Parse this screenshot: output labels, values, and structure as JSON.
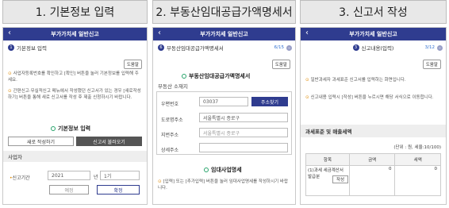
{
  "headers": [
    "1. 기본정보 입력",
    "2. 부동산임대공급가액명세서",
    "3. 신고서 작성"
  ],
  "panel1": {
    "title": "부가가치세 일반신고",
    "step_label": "기본정보 입력",
    "help": "도움말",
    "note1": "사업자등록번호를 확인하고 [확인] 버튼을 눌러 기본정보를 입력해 주세요.",
    "note2": "간편신고·무실적신고 메뉴에서 작성했던 신고서가 있는 경우 [새로작성하기] 버튼을 통해 새로 신고서를 작성 후 제출 신청하시기 바랍니다.",
    "section": "기본정보 입력",
    "btn_new": "새로 작성하기",
    "btn_load": "신고서 불러오기",
    "bar": "사업자",
    "period_label": "신고기간",
    "year": "2021",
    "year_unit": "년",
    "period": "1기",
    "btn_reset": "예정",
    "btn_confirm": "확정"
  },
  "panel2": {
    "title": "부가가치세 일반신고",
    "step_label": "부동산임대공급가액명세서",
    "step_count": "6/15",
    "help": "도움말",
    "section": "부동산임대공급가액명세서",
    "sub": "부동산 소재지",
    "row1_label": "우편번호",
    "row1_value": "03037",
    "row1_btn": "주소찾기",
    "row2_label": "도로명주소",
    "row2_value": "서울특별시 종로구",
    "row3_label": "지번주소",
    "row3_value": "서울특별시 종로구",
    "row4_label": "상세주소",
    "section2": "임대사업명세",
    "note": "[입력] 또는 [추가입력] 버튼을 눌러 임대사업명세를 작성하시기 바랍니다."
  },
  "panel3": {
    "title": "부가가치세 일반신고",
    "step_label": "신고내용(입력)",
    "step_count": "3/12",
    "help": "도움말",
    "note1": "일반과세자 과세표준 신고서를 입력하는 화면입니다.",
    "note2": "신고내용 입력시 [작성] 버튼을 누르시면 해당 서식으로 이동합니다.",
    "bar": "과세표준 및 매출세액",
    "unit": "(단위 : 원, 세율:10/100)",
    "cols": [
      "항목",
      "금액",
      "세액"
    ],
    "row_label": "(1)과세 세금계산서 발급분",
    "row_amount": "0",
    "row_tax": "0",
    "row_btn": "작성"
  }
}
